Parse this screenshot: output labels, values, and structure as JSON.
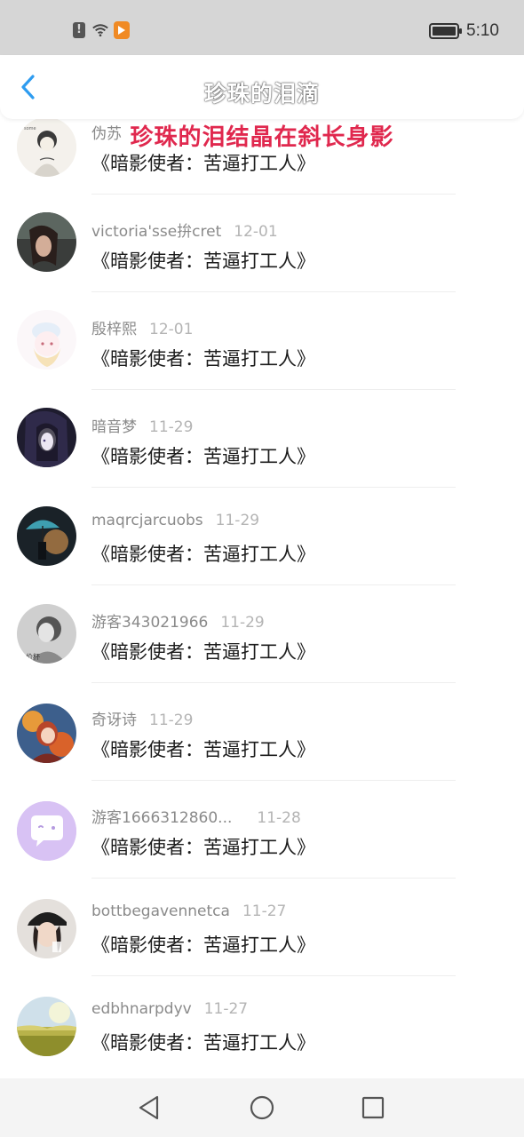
{
  "status_bar": {
    "time": "5:10",
    "icons": [
      "alert-icon",
      "wifi-icon",
      "video-app-icon",
      "battery-icon"
    ]
  },
  "header": {
    "title": "珍珠的泪滴",
    "overlay_title": "珍珠的泪结晶在斜长身影",
    "back_icon": "back-chevron-icon",
    "accent_color": "#2e9cf0",
    "overlay_color": "#e0284e"
  },
  "list": [
    {
      "name": "伪苏",
      "date": "",
      "message": "《暗影使者：苦逼打工人》",
      "avatar": "avatar-sketch-girl"
    },
    {
      "name": "victoria'sse拚cret",
      "date": "12-01",
      "message": "《暗影使者：苦逼打工人》",
      "avatar": "avatar-photo-dark"
    },
    {
      "name": "殷梓熙",
      "date": "12-01",
      "message": "《暗影使者：苦逼打工人》",
      "avatar": "avatar-anime-white"
    },
    {
      "name": "暗音梦",
      "date": "11-29",
      "message": "《暗影使者：苦逼打工人》",
      "avatar": "avatar-anime-dark"
    },
    {
      "name": "maqrcjarcuobs",
      "date": "11-29",
      "message": "《暗影使者：苦逼打工人》",
      "avatar": "avatar-umbrella"
    },
    {
      "name": "游客343021966",
      "date": "11-29",
      "message": "《暗影使者：苦逼打工人》",
      "avatar": "avatar-bw-photo"
    },
    {
      "name": "奇讶诗",
      "date": "11-29",
      "message": "《暗影使者：苦逼打工人》",
      "avatar": "avatar-autumn-girl"
    },
    {
      "name": "游客1666312860...",
      "date": "11-28",
      "message": "《暗影使者：苦逼打工人》",
      "avatar": "avatar-default-chat"
    },
    {
      "name": "bottbegavennetca",
      "date": "11-27",
      "message": "《暗影使者：苦逼打工人》",
      "avatar": "avatar-cap-girl"
    },
    {
      "name": "edbhnarpdyv",
      "date": "11-27",
      "message": "《暗影使者：苦逼打工人》",
      "avatar": "avatar-landscape"
    }
  ],
  "nav": {
    "back": "nav-back-icon",
    "home": "nav-home-icon",
    "recent": "nav-recent-icon"
  }
}
